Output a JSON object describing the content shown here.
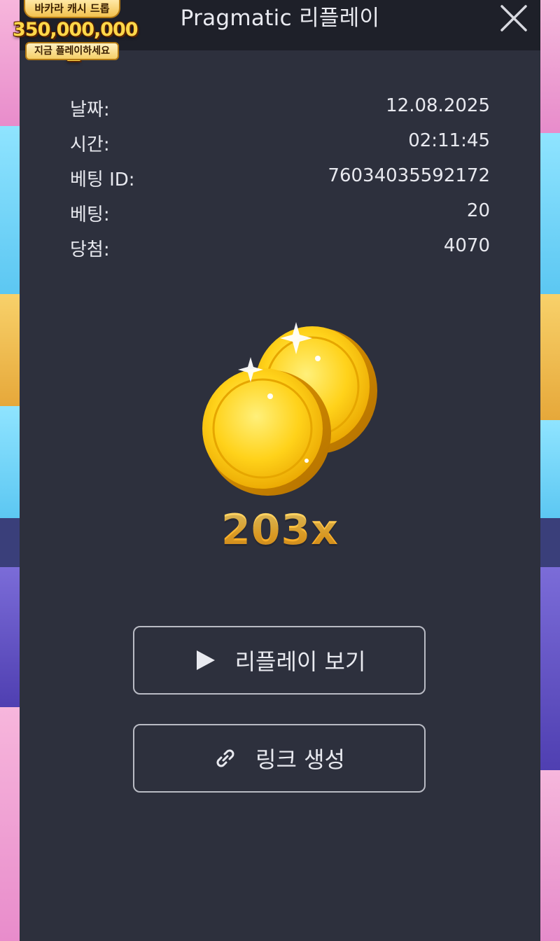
{
  "promo": {
    "top_text": "바카라 캐시 드롭",
    "amount": "350,000,000원",
    "bottom_text": "지금 플레이하세요"
  },
  "header": {
    "title": "Pragmatic 리플레이",
    "close_icon": "close-icon"
  },
  "info": {
    "rows": [
      {
        "label": "날짜:",
        "value": "12.08.2025"
      },
      {
        "label": "시간:",
        "value": "02:11:45"
      },
      {
        "label": "베팅 ID:",
        "value": "76034035592172"
      },
      {
        "label": "베팅:",
        "value": "20"
      },
      {
        "label": "당첨:",
        "value": "4070"
      }
    ]
  },
  "result": {
    "icon": "gold-coins-icon",
    "multiplier": "203x"
  },
  "actions": {
    "replay_label": "리플레이 보기",
    "replay_icon": "play-icon",
    "link_label": "링크 생성",
    "link_icon": "link-icon"
  },
  "colors": {
    "panel_bg": "#2d303d",
    "header_bg": "#1e2029",
    "text": "#e9eaf0",
    "multiplier_gold": "#ffc640",
    "button_border": "#b9bbc4"
  }
}
